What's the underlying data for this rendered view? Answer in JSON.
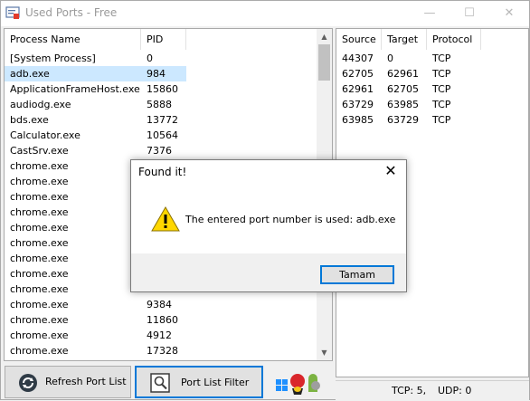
{
  "window": {
    "title": "Used Ports - Free",
    "controls": {
      "minimize": "—",
      "maximize": "☐",
      "close": "✕"
    }
  },
  "process_list": {
    "columns": [
      "Process Name",
      "PID"
    ],
    "rows": [
      [
        "[System Process]",
        "0"
      ],
      [
        "adb.exe",
        "984"
      ],
      [
        "ApplicationFrameHost.exe",
        "15860"
      ],
      [
        "audiodg.exe",
        "5888"
      ],
      [
        "bds.exe",
        "13772"
      ],
      [
        "Calculator.exe",
        "10564"
      ],
      [
        "CastSrv.exe",
        "7376"
      ],
      [
        "chrome.exe",
        ""
      ],
      [
        "chrome.exe",
        ""
      ],
      [
        "chrome.exe",
        ""
      ],
      [
        "chrome.exe",
        ""
      ],
      [
        "chrome.exe",
        ""
      ],
      [
        "chrome.exe",
        ""
      ],
      [
        "chrome.exe",
        ""
      ],
      [
        "chrome.exe",
        ""
      ],
      [
        "chrome.exe",
        ""
      ],
      [
        "chrome.exe",
        "9384"
      ],
      [
        "chrome.exe",
        "11860"
      ],
      [
        "chrome.exe",
        "4912"
      ],
      [
        "chrome.exe",
        "17328"
      ]
    ],
    "selected_index": 1
  },
  "port_list": {
    "columns": [
      "Source",
      "Target",
      "Protocol"
    ],
    "rows": [
      [
        "44307",
        "0",
        "TCP"
      ],
      [
        "62705",
        "62961",
        "TCP"
      ],
      [
        "62961",
        "62705",
        "TCP"
      ],
      [
        "63729",
        "63985",
        "TCP"
      ],
      [
        "63985",
        "63729",
        "TCP"
      ]
    ]
  },
  "buttons": {
    "refresh": "Refresh Port List",
    "filter": "Port List Filter"
  },
  "status": {
    "tcp": "TCP: 5,",
    "udp": "UDP: 0"
  },
  "dialog": {
    "title": "Found it!",
    "message": "The entered port number is used: adb.exe",
    "ok_label": "Tamam",
    "close": "✕"
  },
  "colors": {
    "selection": "#cce8ff",
    "accent": "#0078d7",
    "warning": "#ffd700"
  }
}
